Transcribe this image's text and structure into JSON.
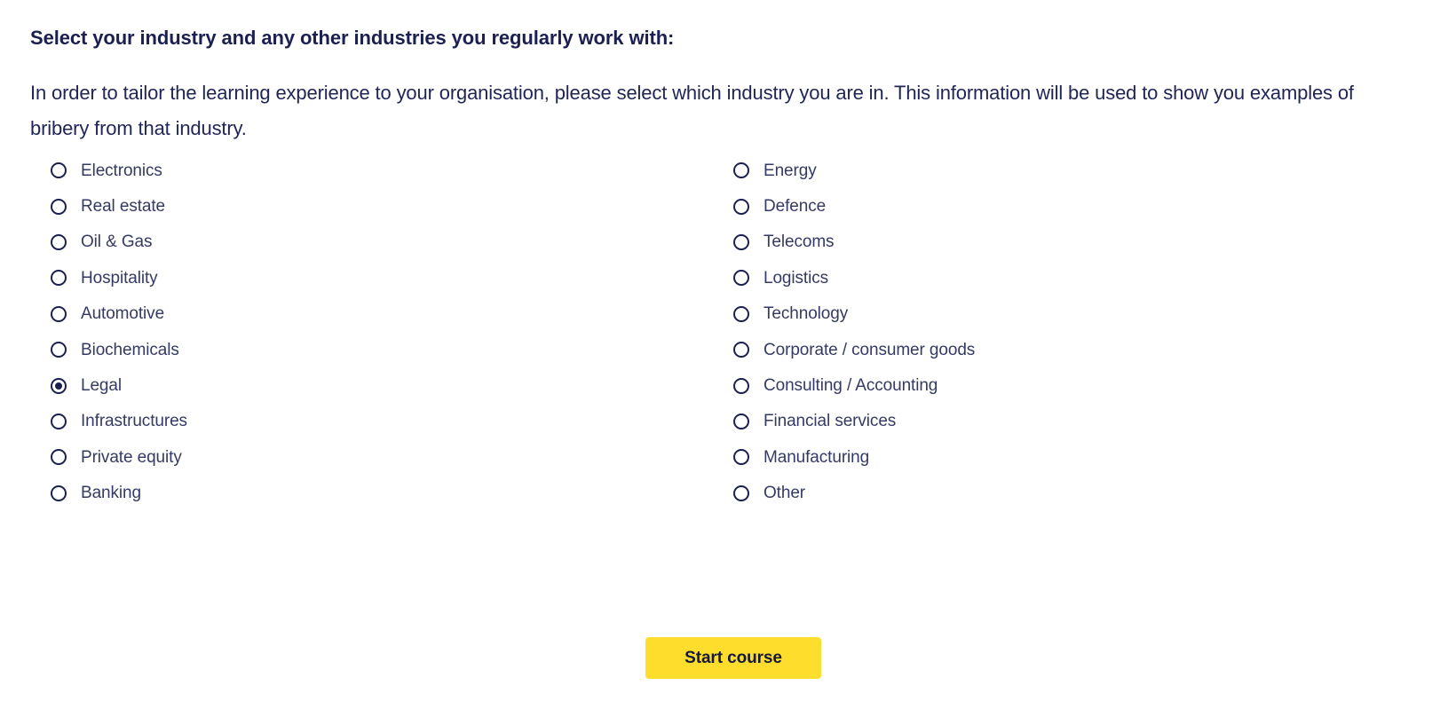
{
  "heading": "Select your industry and any other industries you regularly work with:",
  "intro": "In order to tailor the learning experience to your organisation, please select which industry you are in. This information will be used to show you examples of bribery from that industry.",
  "colors": {
    "heading_navy": "#1b2050",
    "label_navy": "#353a65",
    "button_yellow": "#FFDD2D",
    "button_text": "#15193c",
    "background": "#ffffff"
  },
  "options": {
    "selected": "Legal",
    "left_column": [
      {
        "label": "Electronics",
        "selected": false
      },
      {
        "label": "Real estate",
        "selected": false
      },
      {
        "label": "Oil & Gas",
        "selected": false
      },
      {
        "label": "Hospitality",
        "selected": false
      },
      {
        "label": "Automotive",
        "selected": false
      },
      {
        "label": "Biochemicals",
        "selected": false
      },
      {
        "label": "Legal",
        "selected": true
      },
      {
        "label": "Infrastructures",
        "selected": false
      },
      {
        "label": "Private equity",
        "selected": false
      },
      {
        "label": "Banking",
        "selected": false
      }
    ],
    "right_column": [
      {
        "label": "Energy",
        "selected": false
      },
      {
        "label": "Defence",
        "selected": false
      },
      {
        "label": "Telecoms",
        "selected": false
      },
      {
        "label": "Logistics",
        "selected": false
      },
      {
        "label": "Technology",
        "selected": false
      },
      {
        "label": "Corporate / consumer goods",
        "selected": false
      },
      {
        "label": "Consulting / Accounting",
        "selected": false
      },
      {
        "label": "Financial services",
        "selected": false
      },
      {
        "label": "Manufacturing",
        "selected": false
      },
      {
        "label": "Other",
        "selected": false
      }
    ]
  },
  "footer": {
    "start_button_label": "Start course"
  }
}
